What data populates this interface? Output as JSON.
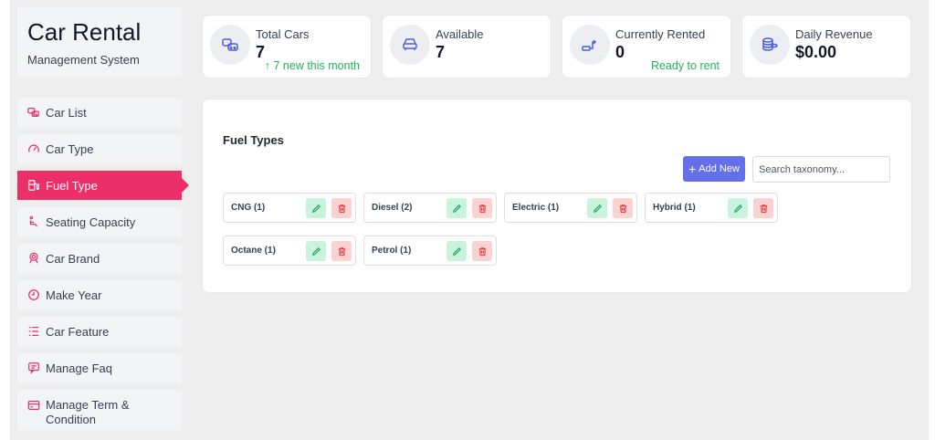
{
  "brand": {
    "title": "Car Rental",
    "subtitle": "Management System"
  },
  "sidebar": {
    "items": [
      {
        "label": "Car List",
        "icon": "car-front-icon"
      },
      {
        "label": "Car Type",
        "icon": "speedometer-icon"
      },
      {
        "label": "Fuel Type",
        "icon": "fuel-pump-icon",
        "active": true
      },
      {
        "label": "Seating Capacity",
        "icon": "seat-icon"
      },
      {
        "label": "Car Brand",
        "icon": "badge-icon"
      },
      {
        "label": "Make Year",
        "icon": "clock-icon"
      },
      {
        "label": "Car Feature",
        "icon": "list-icon"
      },
      {
        "label": "Manage Faq",
        "icon": "chat-icon"
      },
      {
        "label": "Manage Term & Condition",
        "icon": "card-icon"
      }
    ],
    "accent": "#ec2e6a"
  },
  "stats": [
    {
      "label": "Total Cars",
      "value": "7",
      "note": "↑ 7 new this month",
      "icon": "cars-icon"
    },
    {
      "label": "Available",
      "value": "7",
      "note": "",
      "icon": "car-icon"
    },
    {
      "label": "Currently Rented",
      "value": "0",
      "note": "Ready to rent",
      "icon": "route-icon"
    },
    {
      "label": "Daily Revenue",
      "value": "$0.00",
      "note": "",
      "icon": "coins-icon"
    }
  ],
  "panel": {
    "title": "Fuel Types",
    "add_label": "Add New",
    "search_placeholder": "Search taxonomy...",
    "items": [
      {
        "label": "CNG (1)"
      },
      {
        "label": "Diesel (2)"
      },
      {
        "label": "Electric (1)"
      },
      {
        "label": "Hybrid (1)"
      },
      {
        "label": "Octane (1)"
      },
      {
        "label": "Petrol (1)"
      }
    ]
  },
  "colors": {
    "primary": "#6470e8",
    "success": "#22b35e",
    "danger": "#e23b3b"
  }
}
